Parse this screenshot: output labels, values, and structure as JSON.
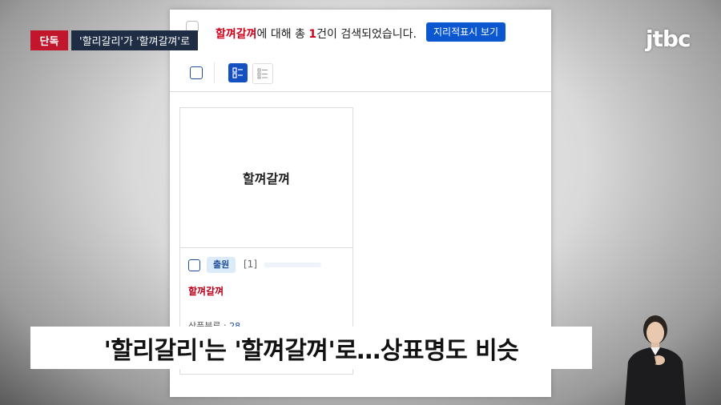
{
  "search_result": {
    "keyword": "할껴갈껴",
    "text_mid": "에 대해 총 ",
    "count": "1",
    "text_end": "건이 검색되었습니다.",
    "geo_button_label": "지리적표시 보기"
  },
  "toolbar": {
    "view_card_icon": "card-view-icon",
    "view_list_icon": "list-view-icon"
  },
  "result_card": {
    "image_text": "할껴갈껴",
    "status": "출원",
    "index": "[1]",
    "title": "할껴갈껴",
    "meta_label": "상품분류 : ",
    "meta_value": "28"
  },
  "broadcast": {
    "tag_exclusive": "단독",
    "tag_headline": "'할리갈리'가 '할껴갈껴'로",
    "logo": "jtbc",
    "caption": "'할리갈리'는 '할껴갈껴'로…상표명도 비슷"
  },
  "colors": {
    "accent_blue": "#0b57d0",
    "highlight_red": "#d0021b",
    "exclusive_red": "#c2162c",
    "headline_navy": "#1e2c44"
  }
}
